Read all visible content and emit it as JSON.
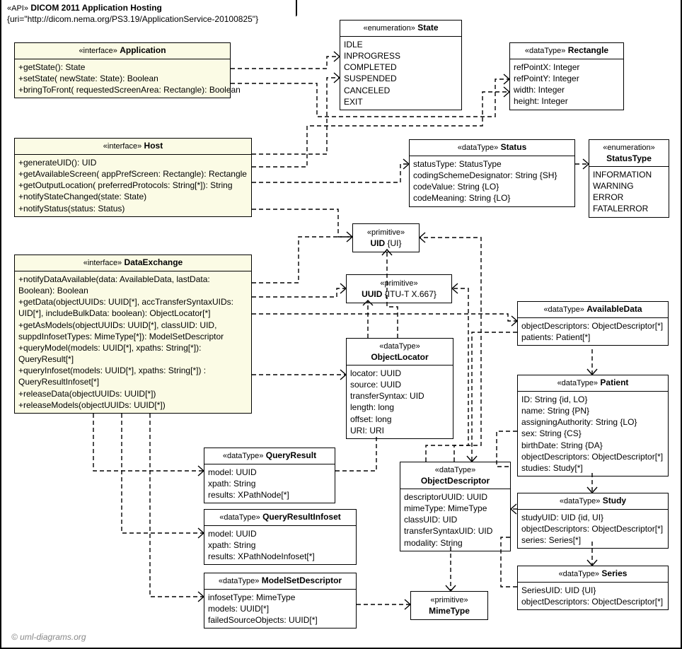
{
  "package": {
    "stereo": "«API»",
    "name": "DICOM 2011 Application Hosting",
    "uri": "{uri=\"http://dicom.nema.org/PS3.19/ApplicationService-20100825\"}"
  },
  "application": {
    "stereo": "«interface»",
    "name": "Application",
    "ops": [
      "+getState(): State",
      "+setState( newState: State): Boolean",
      "+bringToFront( requestedScreenArea: Rectangle): Boolean"
    ]
  },
  "state": {
    "stereo": "«enumeration»",
    "name": "State",
    "vals": [
      "IDLE",
      "INPROGRESS",
      "COMPLETED",
      "SUSPENDED",
      "CANCELED",
      "EXIT"
    ]
  },
  "rectangle": {
    "stereo": "«dataType»",
    "name": "Rectangle",
    "attrs": [
      "refPointX: Integer",
      "refPointY: Integer",
      "width: Integer",
      "height: Integer"
    ]
  },
  "host": {
    "stereo": "«interface»",
    "name": "Host",
    "ops": [
      "+generateUID(): UID",
      "+getAvailableScreen( appPrefScreen: Rectangle): Rectangle",
      "+getOutputLocation( preferredProtocols: String[*]): String",
      "+notifyStateChanged(state: State)",
      "+notifyStatus(status: Status)"
    ]
  },
  "status": {
    "stereo": "«dataType»",
    "name": "Status",
    "attrs": [
      "statusType: StatusType",
      "codingSchemeDesignator: String {SH}",
      "codeValue: String {LO}",
      "codeMeaning: String {LO}"
    ]
  },
  "statusType": {
    "stereo": "«enumeration»",
    "name": "StatusType",
    "vals": [
      "INFORMATION",
      "WARNING",
      "ERROR",
      "FATALERROR"
    ]
  },
  "uid": {
    "stereo": "«primitive»",
    "name": "UID",
    "suffix": "{UI}"
  },
  "uuid": {
    "stereo": "«primitive»",
    "name": "UUID",
    "suffix": "{ITU-T X.667}"
  },
  "dataExchange": {
    "stereo": "«interface»",
    "name": "DataExchange",
    "ops": [
      "+notifyDataAvailable(data: AvailableData, lastData:",
      "Boolean): Boolean",
      "+getData(objectUUIDs: UUID[*], accTransferSyntaxUIDs:",
      "UID[*], includeBulkData: boolean): ObjectLocator[*]",
      "+getAsModels(objectUUIDs: UUID[*], classUID: UID,",
      "suppdInfosetTypes: MimeType[*]): ModelSetDescriptor",
      "+queryModel(models: UUID[*], xpaths: String[*]):",
      "QueryResult[*]",
      "+queryInfoset(models: UUID[*], xpaths: String[*]) :",
      "QueryResultInfoset[*]",
      "+releaseData(objectUUIDs: UUID[*])",
      "+releaseModels(objectUUIDs: UUID[*])"
    ]
  },
  "availableData": {
    "stereo": "«dataType»",
    "name": "AvailableData",
    "attrs": [
      "objectDescriptors: ObjectDescriptor[*]",
      "patients: Patient[*]"
    ]
  },
  "objectLocator": {
    "stereo": "«dataType»",
    "name": "ObjectLocator",
    "attrs": [
      "locator: UUID",
      "source: UUID",
      "transferSyntax: UID",
      "length: long",
      "offset: long",
      "URI: URI"
    ]
  },
  "patient": {
    "stereo": "«dataType»",
    "name": "Patient",
    "attrs": [
      "ID: String {id, LO}",
      "name: String {PN}",
      "assigningAuthority: String {LO}",
      "sex: String {CS}",
      "birthDate: String {DA}",
      "objectDescriptors: ObjectDescriptor[*]",
      "studies: Study[*]"
    ]
  },
  "objectDescriptor": {
    "stereo": "«dataType»",
    "name": "ObjectDescriptor",
    "attrs": [
      "descriptorUUID: UUID",
      "mimeType: MimeType",
      "classUID: UID",
      "transferSyntaxUID: UID",
      "modality: String"
    ]
  },
  "queryResult": {
    "stereo": "«dataType»",
    "name": "QueryResult",
    "attrs": [
      "model: UUID",
      "xpath: String",
      "results: XPathNode[*]"
    ]
  },
  "queryResultInfoset": {
    "stereo": "«dataType»",
    "name": "QueryResultInfoset",
    "attrs": [
      "model: UUID",
      "xpath: String",
      "results: XPathNodeInfoset[*]"
    ]
  },
  "modelSetDescriptor": {
    "stereo": "«dataType»",
    "name": "ModelSetDescriptor",
    "attrs": [
      "infosetType: MimeType",
      "models: UUID[*]",
      "failedSourceObjects: UUID[*]"
    ]
  },
  "study": {
    "stereo": "«dataType»",
    "name": "Study",
    "attrs": [
      "studyUID: UID {id, UI}",
      "objectDescriptors: ObjectDescriptor[*]",
      "series: Series[*]"
    ]
  },
  "series": {
    "stereo": "«dataType»",
    "name": "Series",
    "attrs": [
      "SeriesUID: UID {UI}",
      "objectDescriptors: ObjectDescriptor[*]"
    ]
  },
  "mimeType": {
    "stereo": "«primitive»",
    "name": "MimeType"
  },
  "watermark": "© uml-diagrams.org"
}
